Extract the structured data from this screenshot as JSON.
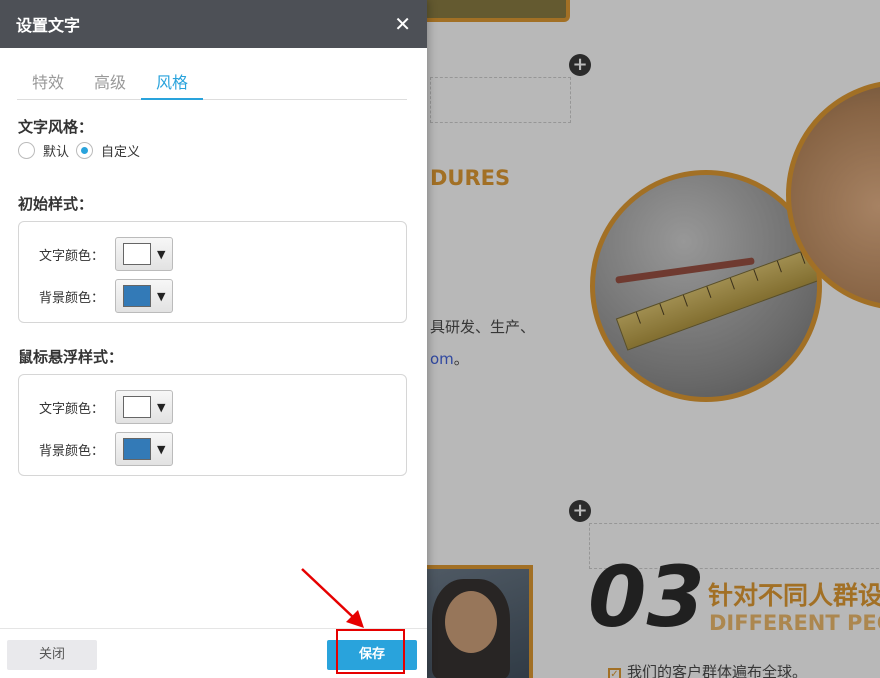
{
  "dialog": {
    "title": "设置文字",
    "close_symbol": "✕",
    "tabs": [
      {
        "label": "特效",
        "active": false
      },
      {
        "label": "高级",
        "active": false
      },
      {
        "label": "风格",
        "active": true
      }
    ],
    "text_style": {
      "label": "文字风格：",
      "options": [
        {
          "label": "默认",
          "checked": false
        },
        {
          "label": "自定义",
          "checked": true
        }
      ]
    },
    "initial_style": {
      "label": "初始样式：",
      "text_color": {
        "label": "文字颜色：",
        "value": "#ffffff"
      },
      "bg_color": {
        "label": "背景颜色：",
        "value": "#337ab7"
      }
    },
    "hover_style": {
      "label": "鼠标悬浮样式：",
      "text_color": {
        "label": "文字颜色：",
        "value": "#ffffff"
      },
      "bg_color": {
        "label": "背景颜色：",
        "value": "#337ab7"
      }
    },
    "footer": {
      "close_label": "关闭",
      "save_label": "保存"
    }
  },
  "background": {
    "heading_en": "DURES",
    "body_text": "具研发、生产、",
    "link_text": "om",
    "link_punct": "。",
    "number": "03",
    "cn_title": "针对不同人群设",
    "en_title": "DIFFERENT PEO",
    "check_text": "我们的客户群体遍布全球。",
    "add_symbol": "+"
  },
  "colors": {
    "accent": "#29a3dc",
    "header_bg": "#4d5056",
    "brand_orange": "#d98c1a",
    "highlight_red": "#e60000"
  }
}
